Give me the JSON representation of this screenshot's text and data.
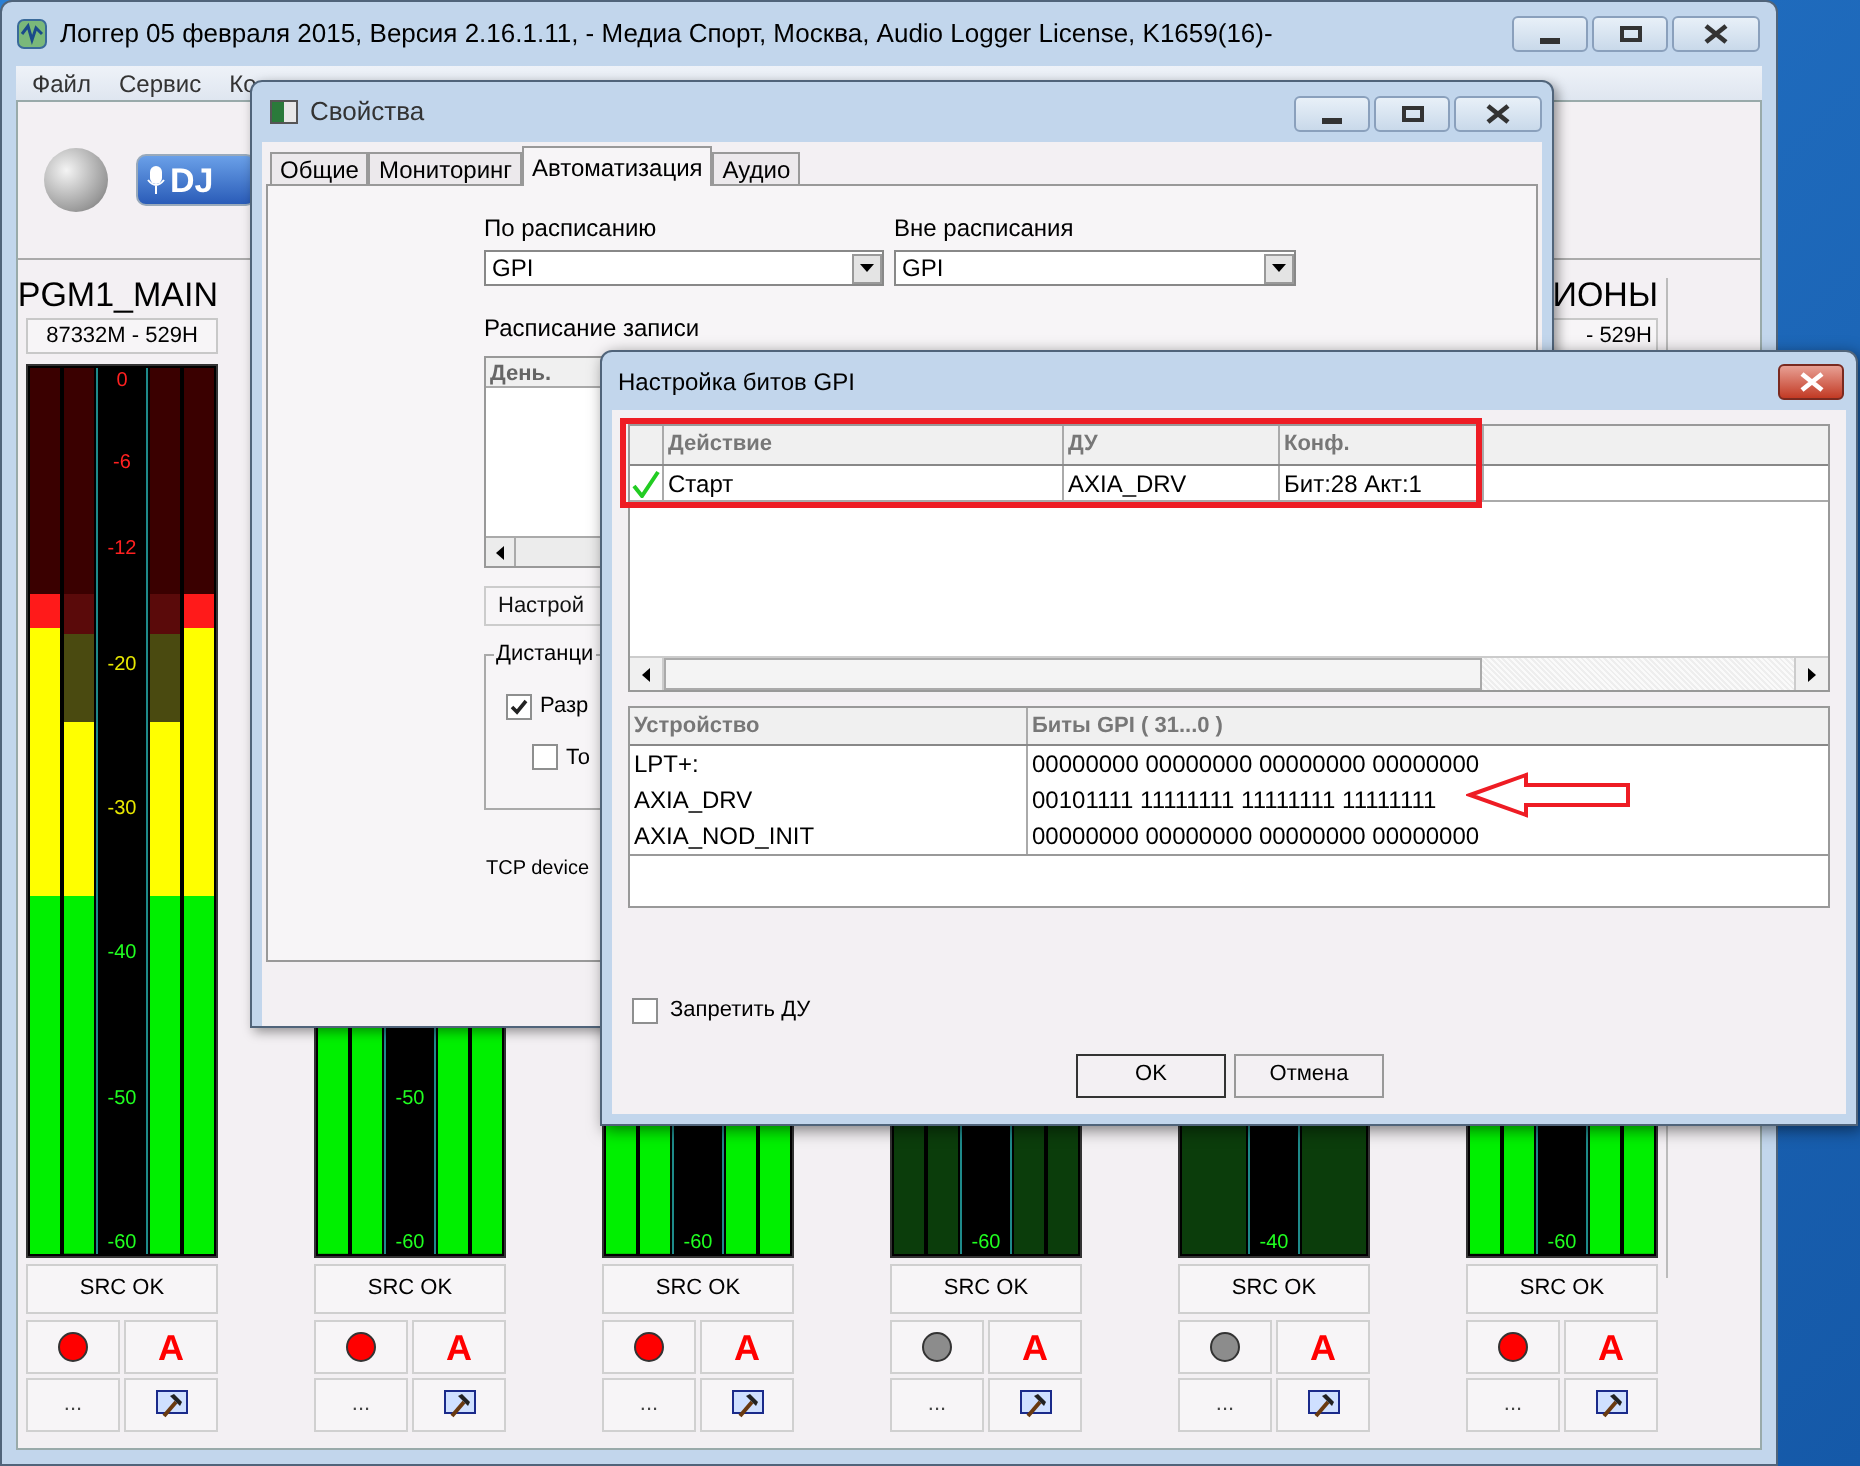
{
  "main_window": {
    "title": "Логгер 05 февраля 2015, Версия 2.16.1.11, - Медиа Спорт, Москва, Audio Logger License, K1659(16)-",
    "menu": [
      "Файл",
      "Сервис",
      "Ко"
    ],
    "logo_text": "DJ",
    "channels": [
      {
        "name": "PGM1_MAIN",
        "counter": "87332M - 529H",
        "bars": [
          {
            "level": 0.745
          },
          {
            "level": 0.6
          },
          {
            "level": 0.6
          },
          {
            "level": 0.745
          }
        ],
        "scale": [
          "0",
          "-6",
          "-12",
          "-20",
          "-30",
          "-40",
          "-50",
          "-60"
        ],
        "status": "SRC OK",
        "recording": true,
        "auto_label": "A",
        "more_label": "..."
      },
      {
        "bars": [
          {
            "level": 0.3
          },
          {
            "level": 0.3
          },
          {
            "level": 0.3
          },
          {
            "level": 0.3
          }
        ],
        "scale": [
          "-50",
          "-60"
        ],
        "status": "SRC OK",
        "recording": true,
        "auto_label": "A",
        "more_label": "..."
      },
      {
        "bars": [
          {
            "level": 0.3
          },
          {
            "level": 0.3
          },
          {
            "level": 0.3
          },
          {
            "level": 0.3
          }
        ],
        "scale": [
          "-60"
        ],
        "status": "SRC OK",
        "recording": true,
        "auto_label": "A",
        "more_label": "..."
      },
      {
        "bars": [
          {
            "level": 0
          },
          {
            "level": 0
          },
          {
            "level": 0
          },
          {
            "level": 0
          }
        ],
        "scale": [
          "-60"
        ],
        "status": "SRC OK",
        "recording": false,
        "auto_label": "A",
        "more_label": "..."
      },
      {
        "bars": [
          {
            "level": 0
          },
          {
            "level": 0
          }
        ],
        "scale": [
          "-40"
        ],
        "status": "SRC OK",
        "recording": false,
        "auto_label": "A",
        "more_label": "..."
      },
      {
        "name": "ИОНЫ",
        "counter": "- 529H",
        "bars": [
          {
            "level": 0.3
          },
          {
            "level": 0.3
          },
          {
            "level": 0.3
          },
          {
            "level": 0.3
          }
        ],
        "scale": [
          "-60"
        ],
        "status": "SRC OK",
        "recording": true,
        "auto_label": "A",
        "more_label": "..."
      }
    ]
  },
  "properties": {
    "title": "Свойства",
    "tabs": [
      {
        "label": "Общие",
        "selected": false
      },
      {
        "label": "Мониторинг",
        "selected": false
      },
      {
        "label": "Автоматизация",
        "selected": true
      },
      {
        "label": "Аудио",
        "selected": false
      }
    ],
    "schedule_label": "По расписанию",
    "schedule_value": "GPI",
    "off_schedule_label": "Вне расписания",
    "off_schedule_value": "GPI",
    "table_label": "Расписание записи",
    "table_columns": [
      "День."
    ],
    "setup_button": "Настрой",
    "group_label": "Дистанци",
    "checkboxes": [
      {
        "label": "Разр",
        "checked": true
      },
      {
        "label": "То",
        "checked": false
      }
    ],
    "tcp_label": "TCP device"
  },
  "gpi_dialog": {
    "title": "Настройка битов GPI",
    "actions": {
      "columns": [
        "Действие",
        "ДУ",
        "Конф."
      ],
      "rows": [
        {
          "active": true,
          "cells": [
            "Старт",
            "AXIA_DRV",
            "Бит:28 Акт:1"
          ]
        }
      ]
    },
    "devices": {
      "columns": [
        "Устройство",
        "Биты GPI ( 31...0 )"
      ],
      "rows": [
        [
          "LPT+:",
          "00000000 00000000 00000000 00000000"
        ],
        [
          "AXIA_DRV",
          "00101111 11111111 11111111 11111111"
        ],
        [
          "AXIA_NOD_INIT",
          "00000000 00000000 00000000 00000000"
        ]
      ]
    },
    "disable_remote": {
      "label": "Запретить ДУ",
      "checked": false
    },
    "buttons": [
      "OK",
      "Отмена"
    ]
  }
}
